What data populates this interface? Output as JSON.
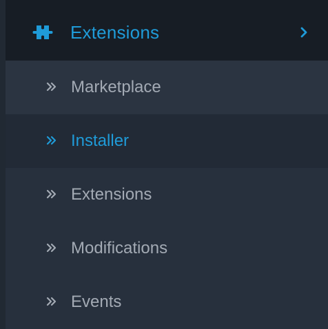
{
  "menu": {
    "header": {
      "label": "Extensions",
      "icon": "puzzle-icon",
      "expand_icon": "chevron-right-icon"
    },
    "items": [
      {
        "label": "Marketplace",
        "icon": "double-chevron-right-icon",
        "active": false
      },
      {
        "label": "Installer",
        "icon": "double-chevron-right-icon",
        "active": true
      },
      {
        "label": "Extensions",
        "icon": "double-chevron-right-icon",
        "active": false
      },
      {
        "label": "Modifications",
        "icon": "double-chevron-right-icon",
        "active": false
      },
      {
        "label": "Events",
        "icon": "double-chevron-right-icon",
        "active": false
      }
    ]
  },
  "colors": {
    "accent": "#1f9bd8",
    "header_background": "#171d25",
    "menu_background": "#27303d",
    "marketplace_background": "#2b3441",
    "active_background": "#222a36",
    "text_muted": "#a3aab4"
  }
}
